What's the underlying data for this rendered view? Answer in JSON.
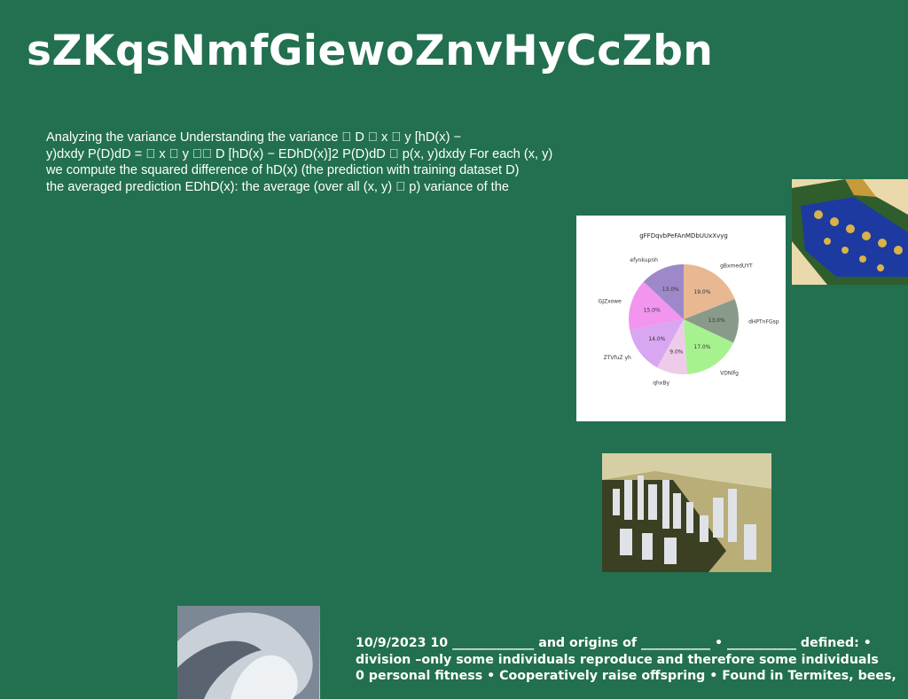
{
  "title": "sZKqsNmfGiewoZnvHyCcZbn",
  "body_lines": [
    "Analyzing the variance Understanding the variance \u0000 D \u0000 x \u0000 y [hD(x) −",
    "y)dxdy P(D)dD = \u0000 x \u0000 y \u0000\u0000 D [hD(x) − EDhD(x)]2 P(D)dD \u0000 p(x, y)dxdy For each (x, y)",
    "we compute the squared difference of hD(x) (the prediction with training dataset D)",
    "the averaged prediction EDhD(x): the average (over all (x, y) \u0000 p) variance of the"
  ],
  "footer_lines": [
    "10/9/2023 10 _____________ and origins of ___________ • ___________ defined: •",
    "division –only some individuals reproduce and therefore some individuals",
    "0 personal fitness • Cooperatively raise offspring • Found in Termites, bees,"
  ],
  "chart_data": {
    "type": "pie",
    "title": "gFFDqvbPeFAnMDbUUxXvyg",
    "categories": [
      "gBxmedUYT",
      "dHPTnFGsp",
      "VDNlfg",
      "qhxBy",
      "ZTVfuZ yh",
      "GJZxowe",
      "efynkupnh"
    ],
    "values": [
      19.0,
      13.0,
      17.0,
      9.0,
      14.0,
      15.0,
      13.0
    ],
    "value_labels": [
      "19.0%",
      "13.0%",
      "17.0%",
      "9.0%",
      "14.0%",
      "15.0%",
      "13.0%"
    ],
    "colors": [
      "#e8b892",
      "#8a9a8a",
      "#a6f28f",
      "#eecbe9",
      "#d9a6f2",
      "#f195ef",
      "#9d88c9"
    ],
    "start_angle_deg": 90,
    "direction": "clockwise",
    "legend": "none"
  },
  "images": {
    "temple": "temple roof photo",
    "city": "city skyline aerial photo",
    "swirl": "abstract metallic swirl"
  }
}
